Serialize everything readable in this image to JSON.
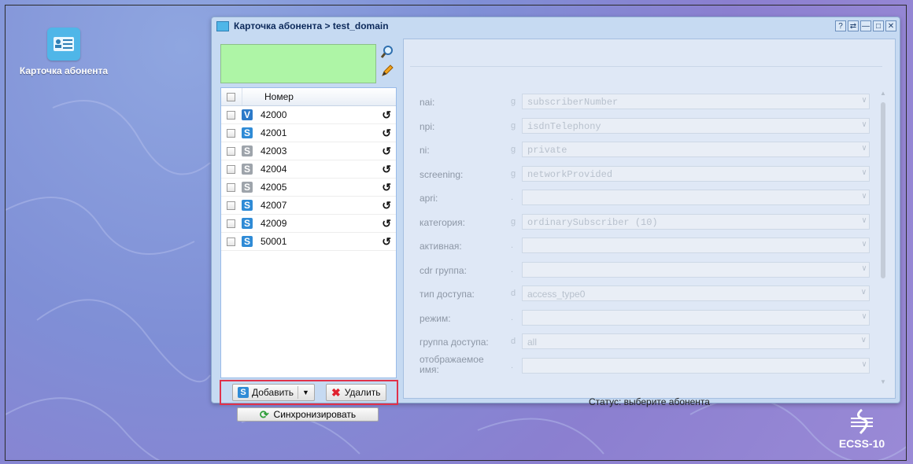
{
  "desktop": {
    "icon_label": "Карточка абонента"
  },
  "window": {
    "title": "Карточка абонента > test_domain",
    "controls": [
      "?",
      "⇄",
      "—",
      "□",
      "✕"
    ]
  },
  "left": {
    "grid_header": "Номер",
    "rows": [
      {
        "type": "V",
        "color": "#2c7ac9",
        "number": "42000"
      },
      {
        "type": "S",
        "color": "#2f8bd6",
        "number": "42001"
      },
      {
        "type": "S",
        "color": "#9ea4ab",
        "number": "42003"
      },
      {
        "type": "S",
        "color": "#9ea4ab",
        "number": "42004"
      },
      {
        "type": "S",
        "color": "#9ea4ab",
        "number": "42005"
      },
      {
        "type": "S",
        "color": "#2f8bd6",
        "number": "42007"
      },
      {
        "type": "S",
        "color": "#2f8bd6",
        "number": "42009"
      },
      {
        "type": "S",
        "color": "#2f8bd6",
        "number": "50001"
      }
    ],
    "add_label": "Добавить",
    "delete_label": "Удалить",
    "sync_label": "Синхронизировать"
  },
  "right": {
    "fields": [
      {
        "label": "nai:",
        "mark": "g",
        "value": "subscriberNumber"
      },
      {
        "label": "npi:",
        "mark": "g",
        "value": "isdnTelephony"
      },
      {
        "label": "ni:",
        "mark": "g",
        "value": "private"
      },
      {
        "label": "screening:",
        "mark": "g",
        "value": "networkProvided"
      },
      {
        "label": "apri:",
        "mark": ".",
        "value": ""
      },
      {
        "label": "категория:",
        "mark": "g",
        "value": "ordinarySubscriber (10)"
      },
      {
        "label": "активная:",
        "mark": ".",
        "value": ""
      },
      {
        "label": "cdr группа:",
        "mark": ".",
        "value": ""
      },
      {
        "label": "тип доступа:",
        "mark": "d",
        "value": "access_type0"
      },
      {
        "label": "режим:",
        "mark": ".",
        "value": ""
      },
      {
        "label": "группа доступа:",
        "mark": "d",
        "value": "all"
      },
      {
        "label": "отображаемое имя:",
        "mark": ".",
        "value": ""
      }
    ],
    "status": "Статус: выберите абонента"
  },
  "logo": {
    "text": "ECSS-10"
  }
}
